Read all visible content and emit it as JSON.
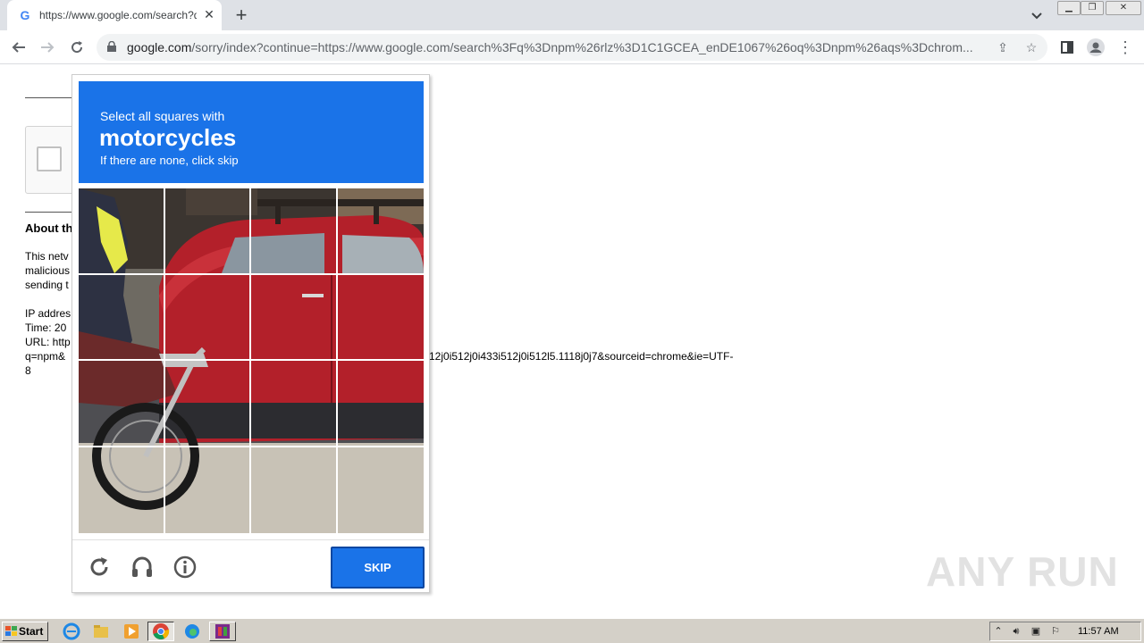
{
  "browser": {
    "tab": {
      "title": "https://www.google.com/search?q=",
      "favicon": "G"
    },
    "address": {
      "host": "google.com",
      "path": "/sorry/index?continue=https://www.google.com/search%3Fq%3Dnpm%26rlz%3D1C1GCEA_enDE1067%26oq%3Dnpm%26aqs%3Dchrom..."
    }
  },
  "page": {
    "about_title": "About th",
    "paragraph_lines": [
      "This netv",
      "malicious",
      "sending t"
    ],
    "info_lines": [
      "IP addres",
      "Time: 20",
      "URL: http"
    ],
    "url_line1_start": "q=npm&",
    "url_line1_end": "12j0i512j0i433i512j0i512l5.1118j0j7&sourceid=chrome&ie=UTF-",
    "url_line2": "8"
  },
  "captcha": {
    "instruction_line1": "Select all squares with",
    "keyword": "motorcycles",
    "instruction_line3": "If there are none, click skip",
    "skip_label": "SKIP",
    "header_color": "#1a73e8"
  },
  "watermark": "ANY RUN",
  "taskbar": {
    "start_label": "Start",
    "clock": "11:57 AM"
  }
}
